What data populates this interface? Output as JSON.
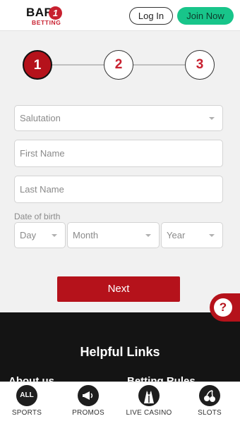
{
  "header": {
    "logo_top": "BAR",
    "logo_badge": "1",
    "logo_sub": "BETTING",
    "login_label": "Log In",
    "join_label": "Join Now"
  },
  "stepper": {
    "steps": [
      "1",
      "2",
      "3"
    ],
    "active_step": 1
  },
  "form": {
    "salutation_placeholder": "Salutation",
    "first_name_placeholder": "First Name",
    "last_name_placeholder": "Last Name",
    "dob_label": "Date of birth",
    "day_placeholder": "Day",
    "month_placeholder": "Month",
    "year_placeholder": "Year",
    "next_label": "Next"
  },
  "help_button": {
    "label": "?"
  },
  "footer": {
    "title": "Helpful Links",
    "links": [
      "About us",
      "Betting Rules"
    ]
  },
  "bottom_nav": {
    "items": [
      {
        "label": "SPORTS",
        "icon": "ALL"
      },
      {
        "label": "PROMOS",
        "icon": "megaphone-icon"
      },
      {
        "label": "LIVE CASINO",
        "icon": "dealer-icon"
      },
      {
        "label": "SLOTS",
        "icon": "cherries-icon"
      }
    ]
  },
  "colors": {
    "brand_red": "#b5121b",
    "join_green": "#18c58a",
    "footer_bg": "#141414"
  }
}
